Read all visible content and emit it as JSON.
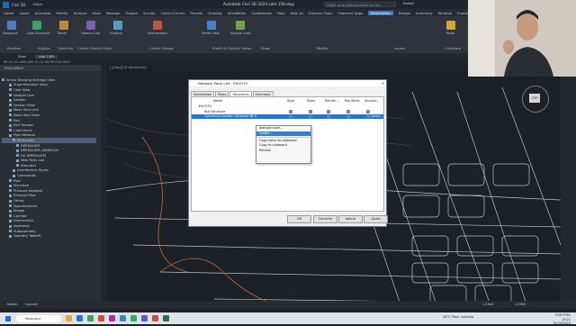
{
  "window": {
    "app_name": "Civil 3D",
    "doc_title": "Autodesk Civil 3D 2024  Lote 158.dwg",
    "search_placeholder": "Digite uma palavra-chave ou fra...",
    "user": "Rafael",
    "share": "Share"
  },
  "menu_tabs": [
    "Home",
    "Insert",
    "Annotate",
    "Modify",
    "Analyze",
    "View",
    "Manage",
    "Output",
    "Survey",
    "Lines+Curves",
    "Parcels",
    "Grading",
    "InfraWorks",
    "Collaborate",
    "Help",
    "Add-ins",
    "Express Tools",
    "Featured Apps",
    "Geolocation",
    "Design",
    "Inventory",
    "Window",
    "Express"
  ],
  "active_menu_tab": "Geolocation",
  "ribbon": {
    "panels": [
      "Palettes",
      "Explore",
      "Optimize",
      "Create Ground Data",
      "Create Design",
      "Profile & Section Views",
      "Draw",
      "Modify",
      "Layers",
      "Clipboard"
    ],
    "buttons": {
      "toolspace": "Toolspace",
      "data_shortcuts": "Data Shortcuts",
      "parcels": "Parcel",
      "feature_line": "Feature Line",
      "grading": "Grading",
      "intersections": "Intersections",
      "profile_view": "Profile View",
      "sample_lines": "Sample Lines",
      "paste": "Paste"
    }
  },
  "doc_tabs": [
    "Start",
    "Lote 158*"
  ],
  "breadcrumb": "RE-01-01-URB-GER-01-01-08-PE-ESG-R04*",
  "viewport_label": "[-][Top][2D Wireframe]",
  "toolspace": {
    "title": "TOOLSPACE",
    "tree": [
      {
        "label": "Active Drawing Settings View",
        "indent": 0,
        "sel": false
      },
      {
        "label": "Superelevation View",
        "indent": 2,
        "sel": false
      },
      {
        "label": "Cant View",
        "indent": 2,
        "sel": false
      },
      {
        "label": "Sample Line",
        "indent": 2,
        "sel": false
      },
      {
        "label": "Section",
        "indent": 2,
        "sel": false
      },
      {
        "label": "Section View",
        "indent": 2,
        "sel": false
      },
      {
        "label": "Mass Haul Line",
        "indent": 2,
        "sel": false
      },
      {
        "label": "Mass Haul View",
        "indent": 2,
        "sel": false
      },
      {
        "label": "Rail",
        "indent": 2,
        "sel": false
      },
      {
        "label": "Rail Turnout",
        "indent": 2,
        "sel": false
      },
      {
        "label": "Catchment",
        "indent": 2,
        "sel": false
      },
      {
        "label": "Pipe Network",
        "indent": 2,
        "sel": false
      },
      {
        "label": "Parts Lists",
        "indent": 3,
        "sel": true
      },
      {
        "label": "DRENAGEM",
        "indent": 4,
        "sel": false
      },
      {
        "label": "DRENAGEM-GENERICA",
        "indent": 4,
        "sel": false
      },
      {
        "label": "HZ-DRENAGEM",
        "indent": 4,
        "sel": false
      },
      {
        "label": "New Parts List",
        "indent": 4,
        "sel": false
      },
      {
        "label": "Standard",
        "indent": 4,
        "sel": false
      },
      {
        "label": "Interference Styles",
        "indent": 3,
        "sel": false
      },
      {
        "label": "Commands",
        "indent": 3,
        "sel": false
      },
      {
        "label": "Pipe",
        "indent": 2,
        "sel": false
      },
      {
        "label": "Structure",
        "indent": 2,
        "sel": false
      },
      {
        "label": "Pressure Network",
        "indent": 2,
        "sel": false
      },
      {
        "label": "Pressure Pipe",
        "indent": 2,
        "sel": false
      },
      {
        "label": "Fitting",
        "indent": 2,
        "sel": false
      },
      {
        "label": "Appurtenance",
        "indent": 2,
        "sel": false
      },
      {
        "label": "Bridge",
        "indent": 2,
        "sel": false
      },
      {
        "label": "Corridor",
        "indent": 2,
        "sel": false
      },
      {
        "label": "Intersection",
        "indent": 2,
        "sel": false
      },
      {
        "label": "Assembly",
        "indent": 2,
        "sel": false
      },
      {
        "label": "Subassembly",
        "indent": 2,
        "sel": false
      },
      {
        "label": "Quantity Takeoff",
        "indent": 2,
        "sel": false
      }
    ]
  },
  "dialog": {
    "title": "Network Parts List - ESGOTO",
    "close": "✕",
    "tabs": [
      "Information",
      "Pipes",
      "Structures",
      "Summary"
    ],
    "active_tab": "Structures",
    "headers": [
      "Name",
      "Style",
      "Rules",
      "Render ...",
      "Pay Items",
      "Structur..."
    ],
    "rows": [
      {
        "label": "ESGOTO",
        "indent": 4,
        "sel": false
      },
      {
        "label": "Null Structure",
        "indent": 10,
        "sel": false
      },
      {
        "label": "Cylindrical Junction Structure NF S",
        "indent": 10,
        "sel": true
      }
    ],
    "selected_row_extra": "Concr...",
    "buttons": [
      "OK",
      "Cancelar",
      "Aplicar",
      "Ajuda"
    ]
  },
  "context_menu": [
    "Add part size...",
    "Delete...",
    "Copy value to clipboard",
    "Copy to clipboard",
    "Refresh"
  ],
  "context_highlight": 1,
  "model_tabs": [
    "Model",
    "Layout1"
  ],
  "navcube": {
    "top_label": "TOP"
  },
  "taskbar": {
    "search": "Pesquisar",
    "weather": "26°C  Pred. nublado",
    "time": "19:21",
    "date": "31/10/2023",
    "lang": "POR PTB2"
  },
  "status": {
    "scale": "1:1000",
    "units": "1.0000"
  }
}
